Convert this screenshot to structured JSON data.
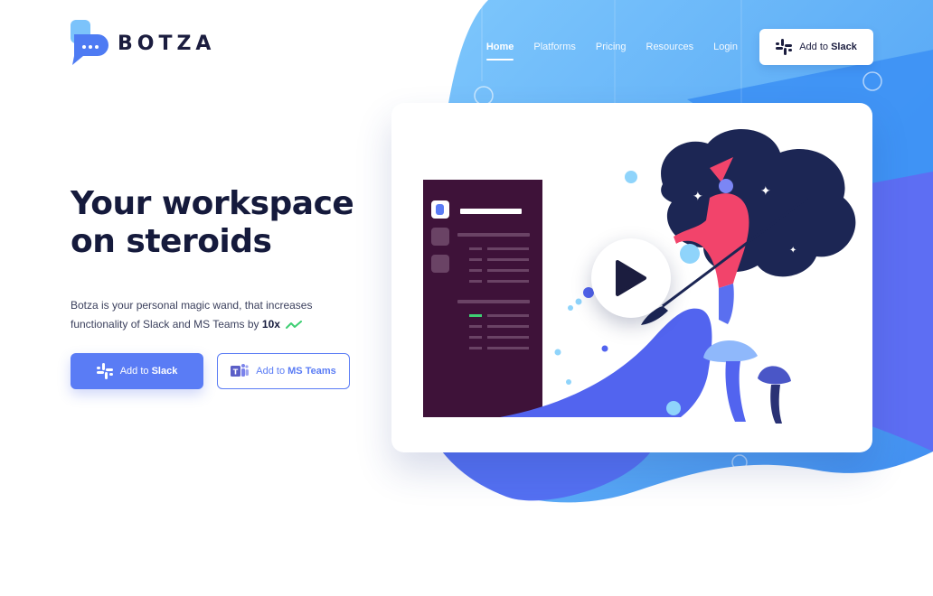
{
  "brand": {
    "name": "BOTZA"
  },
  "nav": {
    "items": [
      "Home",
      "Platforms",
      "Pricing",
      "Resources",
      "Login"
    ],
    "active": "Home",
    "cta_prefix": "Add to",
    "cta_bold": "Slack"
  },
  "hero": {
    "title_line1": "Your workspace",
    "title_line2": "on steroids",
    "desc_part1": "Botza is your personal magic wand, that increases functionality of Slack and MS Teams by",
    "desc_emphasis": "10x",
    "primary_prefix": "Add to",
    "primary_bold": "Slack",
    "secondary_prefix": "Add to",
    "secondary_bold": "MS Teams"
  },
  "colors": {
    "accent": "#5a7cf5",
    "hero_blue": "#3d8ff2",
    "light_blue": "#7cc3fb",
    "dark_navy": "#151a3c",
    "slack_sidebar": "#3e1239",
    "wizard_red": "#f2446b",
    "check_green": "#3ecf73"
  },
  "icons": {
    "logo": "botza-chat-logo-icon",
    "slack": "slack-icon",
    "teams": "ms-teams-icon",
    "play": "play-icon",
    "check": "check-trend-icon"
  }
}
